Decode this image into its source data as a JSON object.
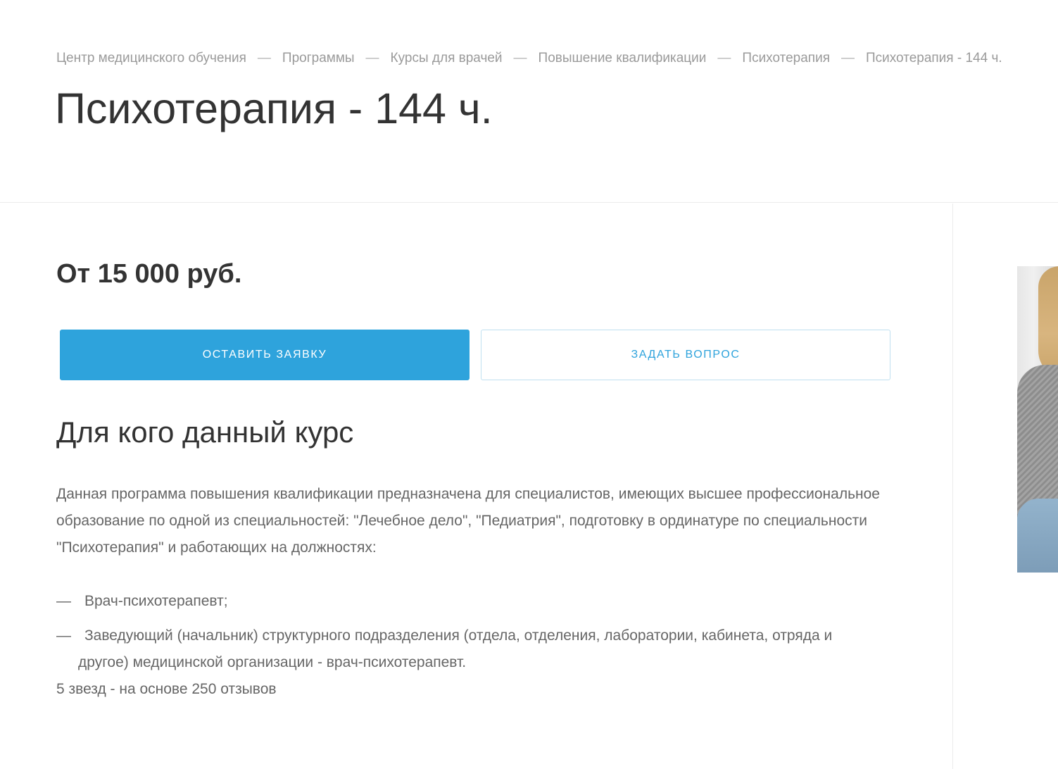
{
  "breadcrumb": {
    "items": [
      "Центр медицинского обучения",
      "Программы",
      "Курсы для врачей",
      "Повышение квалификации",
      "Психотерапия",
      "Психотерапия - 144 ч."
    ],
    "separator": "—"
  },
  "page": {
    "title": "Психотерапия - 144 ч."
  },
  "offer": {
    "price": "От 15 000 руб.",
    "apply_label": "ОСТАВИТЬ ЗАЯВКУ",
    "ask_label": "ЗАДАТЬ ВОПРОС"
  },
  "audience": {
    "title": "Для кого данный курс",
    "description": "Данная программа повышения квалификации предназначена для специалистов, имеющих высшее профессиональное образование по одной из специальностей: \"Лечебное дело\", \"Педиатрия\", подготовку в ординатуре по специальности \"Психотерапия\" и работающих на должностях:",
    "dash": "—",
    "positions": [
      "Врач-психотерапевт;",
      "Заведующий (начальник) структурного подразделения (отдела, отделения, лаборатории, кабинета, отряда и",
      "другое) медицинской организации - врач-психотерапевт."
    ]
  },
  "rating": {
    "text": "5 звезд - на основе 250 отзывов"
  },
  "colors": {
    "accent": "#2ea3dc",
    "text": "#333333",
    "muted": "#666666",
    "breadcrumb": "#9a9a9a"
  },
  "icons": {
    "photo": "person-photo"
  }
}
